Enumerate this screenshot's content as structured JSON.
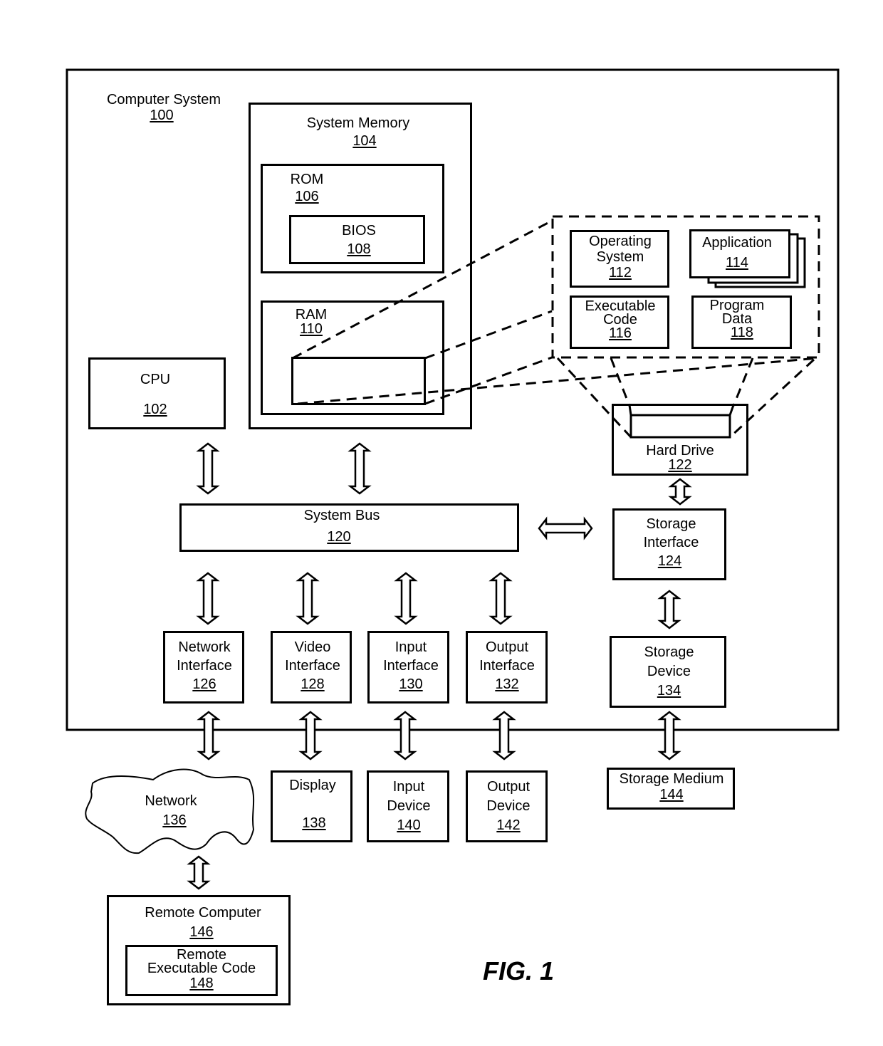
{
  "figure_label": "FIG. 1",
  "computer_system": {
    "name": "Computer System",
    "ref": "100"
  },
  "system_memory": {
    "name": "System Memory",
    "ref": "104"
  },
  "rom": {
    "name": "ROM",
    "ref": "106"
  },
  "bios": {
    "name": "BIOS",
    "ref": "108"
  },
  "ram": {
    "name": "RAM",
    "ref": "110"
  },
  "cpu": {
    "name": "CPU",
    "ref": "102"
  },
  "operating_system": {
    "line1": "Operating",
    "line2": "System",
    "ref": "112"
  },
  "application": {
    "name": "Application",
    "ref": "114"
  },
  "executable_code": {
    "line1": "Executable",
    "line2": "Code",
    "ref": "116"
  },
  "program_data": {
    "line1": "Program",
    "line2": "Data",
    "ref": "118"
  },
  "system_bus": {
    "name": "System Bus",
    "ref": "120"
  },
  "hard_drive": {
    "name": "Hard Drive",
    "ref": "122"
  },
  "storage_interface": {
    "line1": "Storage",
    "line2": "Interface",
    "ref": "124"
  },
  "network_interface": {
    "line1": "Network",
    "line2": "Interface",
    "ref": "126"
  },
  "video_interface": {
    "line1": "Video",
    "line2": "Interface",
    "ref": "128"
  },
  "input_interface": {
    "line1": "Input",
    "line2": "Interface",
    "ref": "130"
  },
  "output_interface": {
    "line1": "Output",
    "line2": "Interface",
    "ref": "132"
  },
  "storage_device": {
    "line1": "Storage",
    "line2": "Device",
    "ref": "134"
  },
  "network": {
    "name": "Network",
    "ref": "136"
  },
  "display": {
    "name": "Display",
    "ref": "138"
  },
  "input_device": {
    "line1": "Input",
    "line2": "Device",
    "ref": "140"
  },
  "output_device": {
    "line1": "Output",
    "line2": "Device",
    "ref": "142"
  },
  "storage_medium": {
    "name": "Storage Medium",
    "ref": "144"
  },
  "remote_computer": {
    "name": "Remote Computer",
    "ref": "146"
  },
  "remote_executable_code": {
    "line1": "Remote",
    "line2": "Executable Code",
    "ref": "148"
  }
}
